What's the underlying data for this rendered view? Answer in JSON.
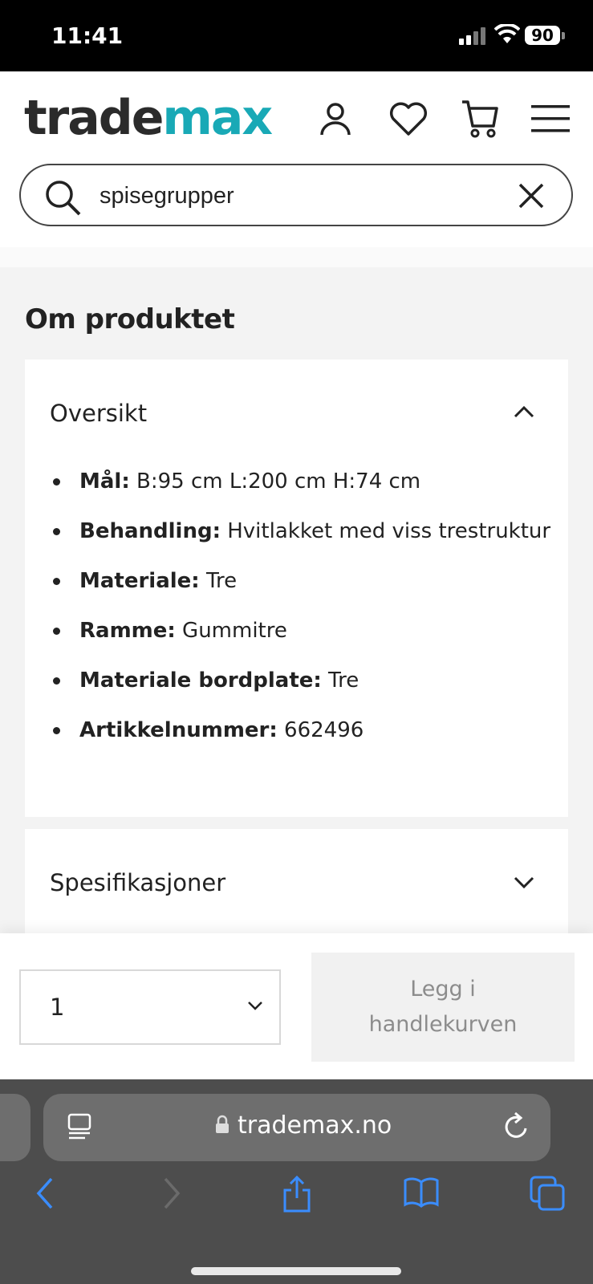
{
  "status_bar": {
    "time": "11:41",
    "battery": "90"
  },
  "brand": {
    "logo_part1": "trade",
    "logo_part2": "max",
    "color_dark": "#2b2b2b",
    "color_accent": "#19a9b6"
  },
  "header_icons": [
    "user-icon",
    "heart-icon",
    "cart-icon",
    "menu-icon"
  ],
  "search": {
    "value": "spisegrupper"
  },
  "product_info": {
    "section_title": "Om produktet",
    "overview": {
      "title": "Oversikt",
      "items": [
        {
          "label": "Mål:",
          "value": " B:95 cm L:200 cm H:74 cm"
        },
        {
          "label": "Behandling:",
          "value": " Hvitlakket med viss trestruktur"
        },
        {
          "label": "Materiale:",
          "value": " Tre"
        },
        {
          "label": "Ramme:",
          "value": " Gummitre"
        },
        {
          "label": "Materiale bordplate:",
          "value": " Tre"
        },
        {
          "label": "Artikkelnummer:",
          "value": " 662496"
        }
      ]
    },
    "specifications": {
      "title": "Spesifikasjoner"
    }
  },
  "cart_bar": {
    "quantity": "1",
    "add_button_label": "Legg i handlekurven"
  },
  "browser": {
    "url": "trademax.no"
  }
}
